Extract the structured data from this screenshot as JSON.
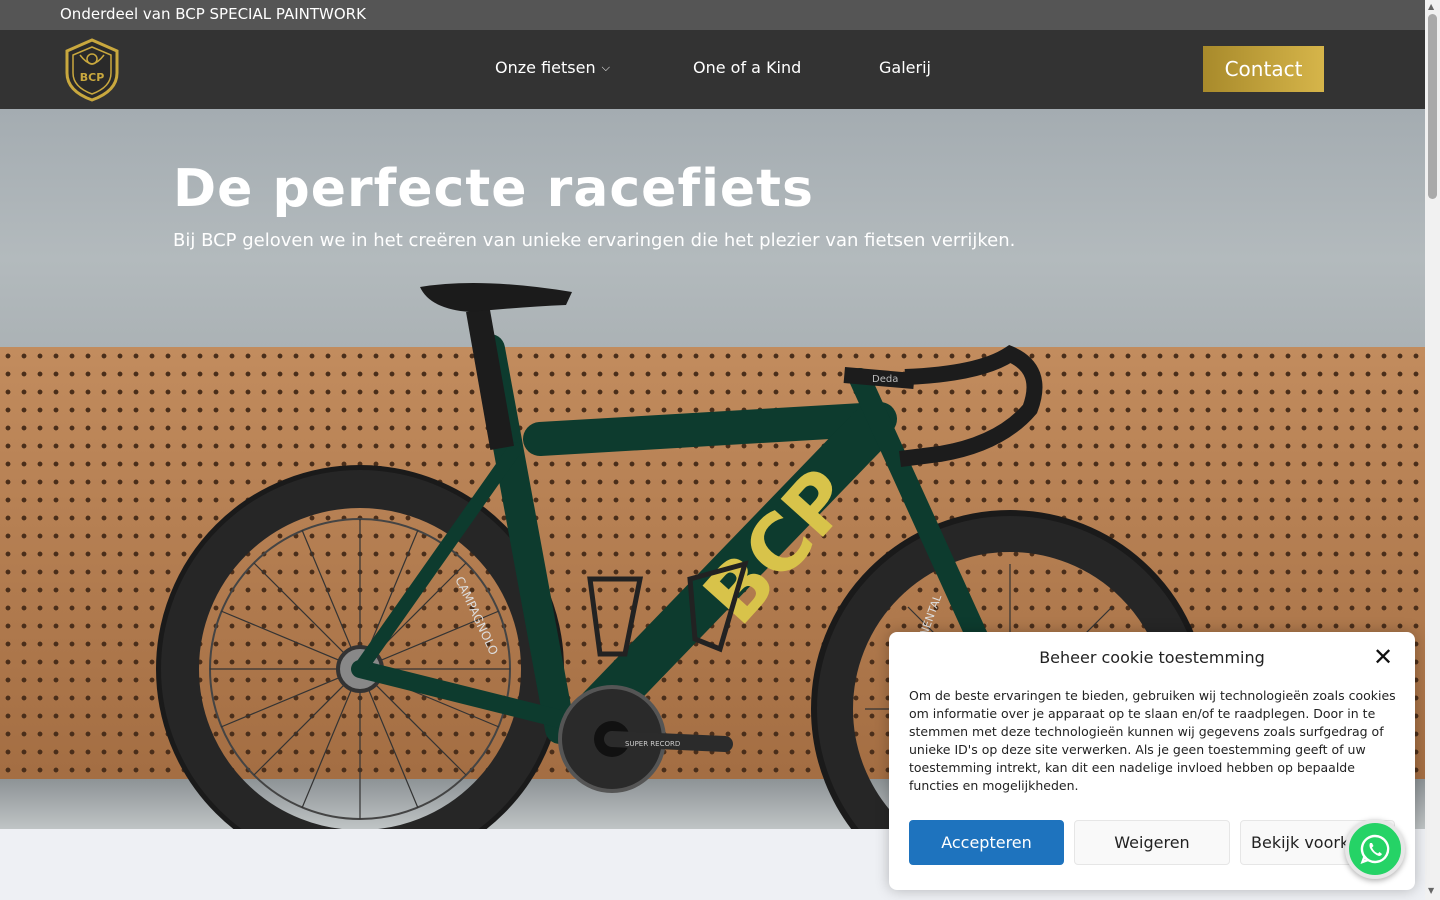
{
  "topbar": {
    "text": "Onderdeel van BCP SPECIAL PAINTWORK"
  },
  "header": {
    "logo_text": "BCP",
    "nav": [
      {
        "label": "Onze fietsen",
        "has_dropdown": true
      },
      {
        "label": "One of a Kind"
      },
      {
        "label": "Galerij"
      }
    ],
    "contact_label": "Contact"
  },
  "hero": {
    "title": "De perfecte racefiets",
    "subtitle": "Bij BCP geloven we in het creëren van unieke ervaringen die het plezier van fietsen verrijken.",
    "frame_text": "BCP",
    "stem_text": "Deda",
    "crank_text": "SUPER RECORD",
    "wheel_text": "CAMPAGNOLO",
    "tire_text": "CONTINENTAL"
  },
  "cookie": {
    "title": "Beheer cookie toestemming",
    "text": "Om de beste ervaringen te bieden, gebruiken wij technologieën zoals cookies om informatie over je apparaat op te slaan en/of te raadplegen. Door in te stemmen met deze technologieën kunnen wij gegevens zoals surfgedrag of unieke ID's op deze site verwerken. Als je geen toestemming geeft of uw toestemming intrekt, kan dit een nadelige invloed hebben op bepaalde functies en mogelijkheden.",
    "accept_label": "Accepteren",
    "deny_label": "Weigeren",
    "preferences_label": "Bekijk voorkeuren"
  },
  "icons": {
    "close": "close-icon",
    "whatsapp": "whatsapp-icon",
    "chevron": "chevron-down-icon"
  },
  "colors": {
    "topbar": "#555555",
    "header": "#333333",
    "accent_gold": "#c9a83e",
    "accept_blue": "#1e73be",
    "whatsapp_green": "#25d366"
  }
}
